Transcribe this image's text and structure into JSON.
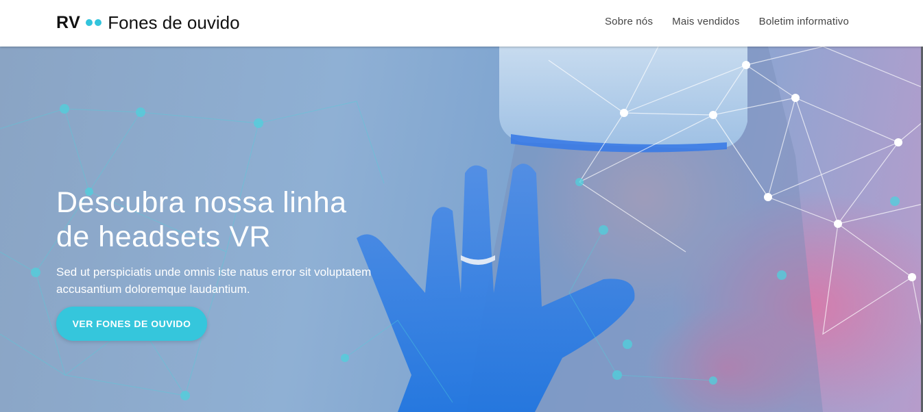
{
  "header": {
    "brand_short": "RV",
    "brand_name": "Fones de ouvido",
    "nav": [
      {
        "label": "Sobre nós"
      },
      {
        "label": "Mais vendidos"
      },
      {
        "label": "Boletim informativo"
      }
    ]
  },
  "hero": {
    "title_line1": "Descubra nossa linha",
    "title_line2": "de headsets VR",
    "subtitle_line1": "Sed ut perspiciatis unde omnis iste natus error sit voluptatem",
    "subtitle_line2": "accusantium doloremque laudantium.",
    "cta_label": "VER FONES DE OUVIDO"
  },
  "colors": {
    "accent": "#35c6dc",
    "header_bg": "#ffffff",
    "hero_text": "#ffffff"
  }
}
